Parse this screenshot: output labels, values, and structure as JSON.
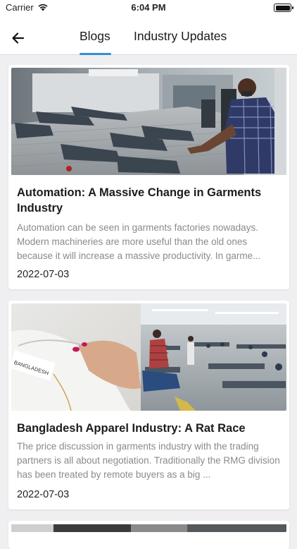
{
  "status_bar": {
    "carrier": "Carrier",
    "time": "6:04 PM"
  },
  "header": {
    "back_icon": "arrow-left-icon",
    "tabs": [
      {
        "label": "Blogs",
        "active": true
      },
      {
        "label": "Industry Updates",
        "active": false
      }
    ],
    "accent_color": "#2f8fd8"
  },
  "posts": [
    {
      "title": "Automation: A Massive Change in Garments Industry",
      "excerpt": "Automation can be seen in garments factories nowadays. Modern machineries are more useful than the old ones because it will increase a massive productivity.  In garme...",
      "date": "2022-07-03",
      "image": "factory-worker-folding-jeans-photo"
    },
    {
      "title": "Bangladesh Apparel Industry:  A Rat Race",
      "excerpt": "The price discussion in garments industry with the trading partners is all about negotiation. Traditionally the RMG division has been treated by remote buyers as a big ...",
      "date": "2022-07-03",
      "image": "garment-label-and-sewing-floor-photo",
      "image_label_text": "BANGLADESH"
    }
  ]
}
